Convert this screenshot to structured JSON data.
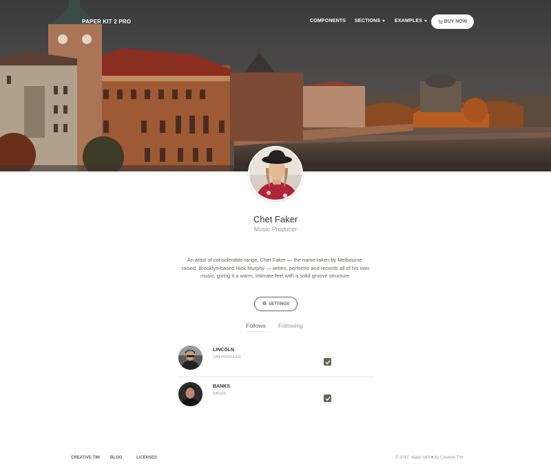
{
  "navbar": {
    "brand": "PAPER KIT 2 PRO",
    "items": [
      {
        "label": "COMPONENTS",
        "dropdown": false
      },
      {
        "label": "SECTIONS",
        "dropdown": true
      },
      {
        "label": "EXAMPLES",
        "dropdown": true
      }
    ],
    "buy_label": "BUY NOW",
    "buy_icon": "shopping-cart-icon"
  },
  "profile": {
    "name": "Chet Faker",
    "title": "Music Producer",
    "bio": "An artist of considerable range, Chet Faker — the name taken by Melbourne-raised, Brooklyn-based Nick Murphy — writes, performs and records all of his own music, giving it a warm, intimate feel with a solid groove structure.",
    "settings_label": "SETTINGS",
    "settings_icon": "gear-icon"
  },
  "tabs": [
    {
      "label": "Follows",
      "active": true
    },
    {
      "label": "Following",
      "active": false
    }
  ],
  "follows": [
    {
      "name": "LINCOLN",
      "role": "CAR PRODUCER",
      "checked": true
    },
    {
      "name": "BANKS",
      "role": "SINGER",
      "checked": true
    }
  ],
  "footer": {
    "links": [
      "CREATIVE TIM",
      "BLOG",
      "LICENSES"
    ],
    "copyright_prefix": "© 2017, made with",
    "copyright_suffix": "by Creative Tim",
    "heart_icon": "heart-icon"
  },
  "colors": {
    "accent": "#eb5e28",
    "text": "#66615b",
    "muted": "#9a9a9a"
  }
}
